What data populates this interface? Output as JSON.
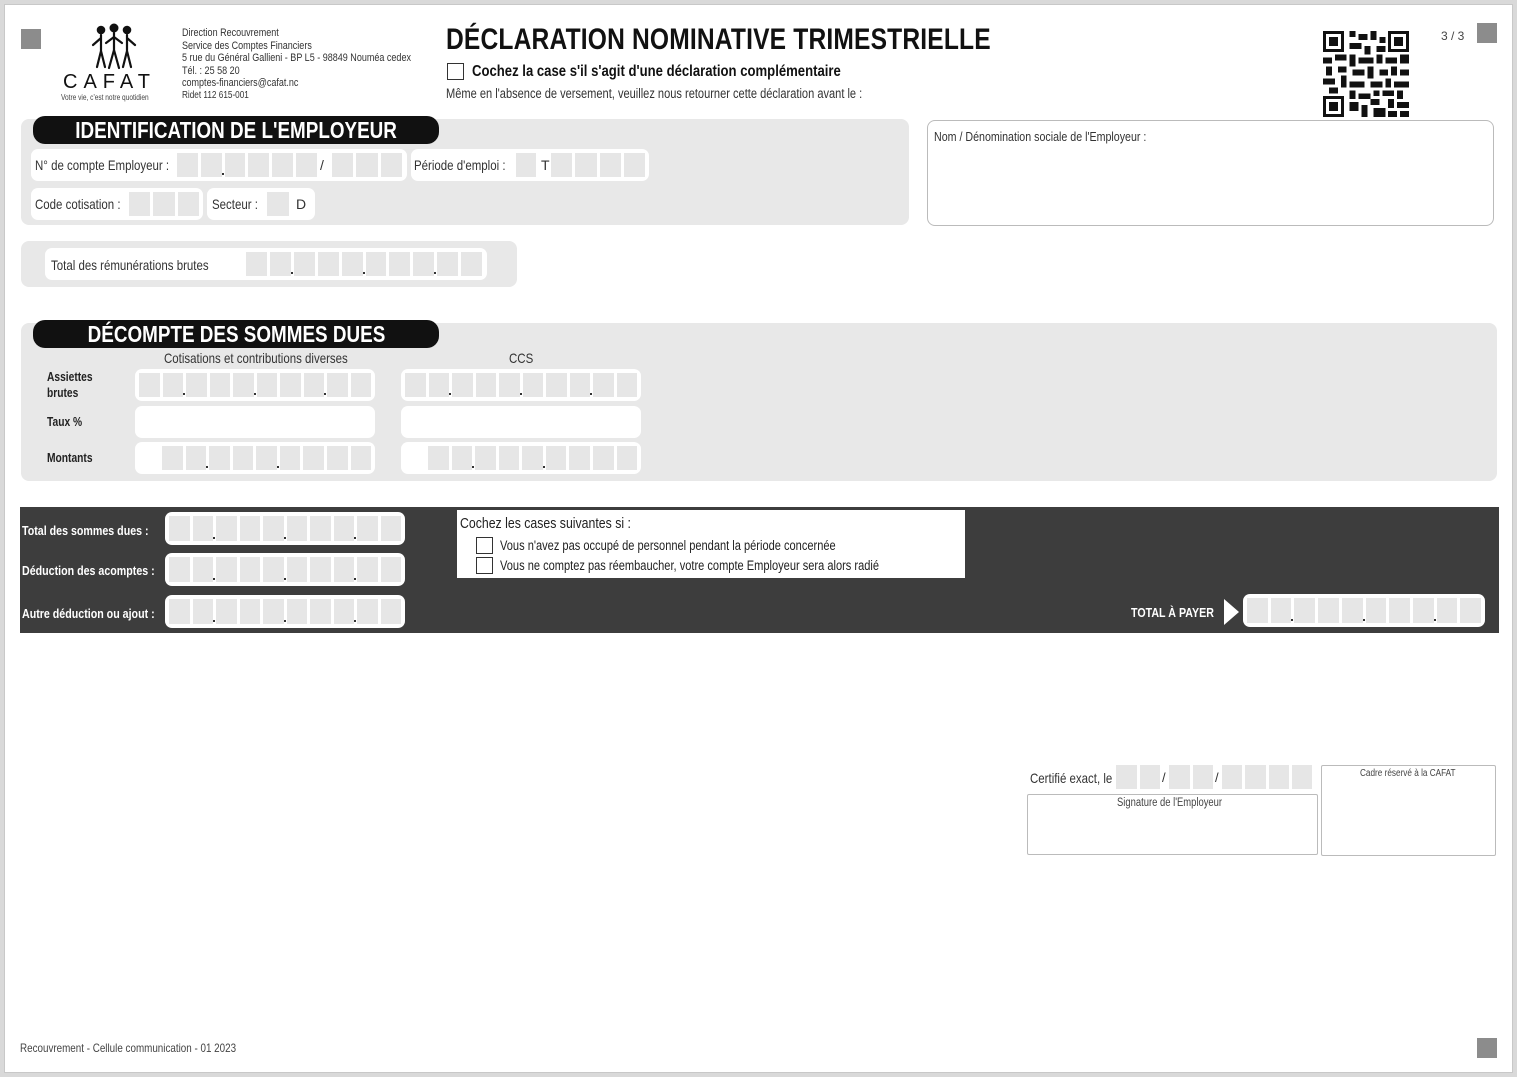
{
  "header": {
    "logo_text": "CAFAT",
    "logo_tagline": "Votre vie, c'est notre quotidien",
    "address_lines": [
      "Direction Recouvrement",
      "Service des Comptes Financiers",
      "5 rue du Général Gallieni - BP L5 - 98849 Nouméa cedex",
      "Tél. : 25 58 20",
      "comptes-financiers@cafat.nc",
      "Ridet 112 615-001"
    ],
    "title": "DÉCLARATION NOMINATIVE TRIMESTRIELLE",
    "complementary_label": "Cochez la case s'il s'agit d'une déclaration complémentaire",
    "notice": "Même en l'absence de versement, veuillez nous retourner cette déclaration avant le :",
    "page_number": "3 / 3"
  },
  "employer": {
    "section_title": "IDENTIFICATION DE L'EMPLOYEUR",
    "account_label": "N° de compte Employeur :",
    "account_separator": "/",
    "period_label": "Période d'emploi :",
    "period_prefix": "T",
    "code_label": "Code cotisation :",
    "sector_label": "Secteur :",
    "sector_value": "D",
    "name_label": "Nom / Dénomination sociale de l'Employeur :",
    "gross_total_label": "Total des rémunérations brutes"
  },
  "decompte": {
    "section_title": "DÉCOMPTE DES SOMMES DUES",
    "col1_header": "Cotisations et contributions diverses",
    "col2_header": "CCS",
    "row_assiettes": "Assiettes brutes",
    "row_taux": "Taux %",
    "row_montants": "Montants"
  },
  "totals": {
    "total_due_label": "Total des sommes dues :",
    "deduction_label": "Déduction des acomptes :",
    "other_label": "Autre déduction ou ajout :",
    "check_title": "Cochez les cases suivantes si :",
    "check_no_staff": "Vous n'avez pas occupé de personnel pendant la période concernée",
    "check_no_rehire": "Vous ne comptez pas réembaucher, votre compte Employeur sera alors radié",
    "total_to_pay_label": "TOTAL À PAYER"
  },
  "signature": {
    "certified_label": "Certifié exact, le",
    "date_sep": "/",
    "signature_label": "Signature de l'Employeur",
    "reserved_label": "Cadre réservé à la CAFAT"
  },
  "footer": {
    "text": "Recouvrement - Cellule communication - 01 2023"
  }
}
